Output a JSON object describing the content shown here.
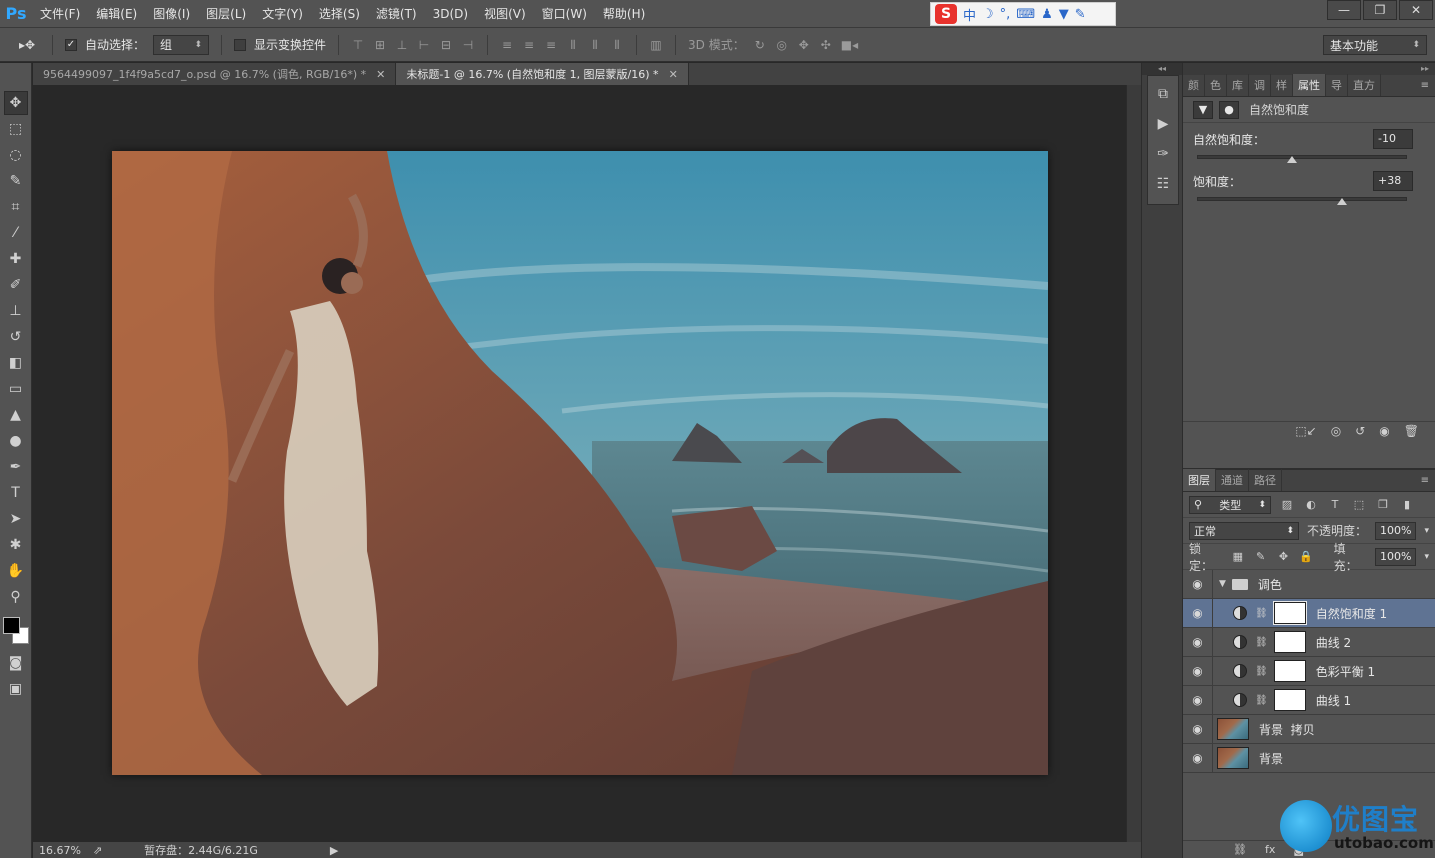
{
  "app": {
    "logo": "Ps"
  },
  "menu": [
    "文件(F)",
    "编辑(E)",
    "图像(I)",
    "图层(L)",
    "文字(Y)",
    "选择(S)",
    "滤镜(T)",
    "3D(D)",
    "视图(V)",
    "窗口(W)",
    "帮助(H)"
  ],
  "ime": {
    "logo": "S",
    "mode": "中",
    "icons": [
      "moon-icon",
      "punctuation-icon",
      "keyboard-icon",
      "user-icon",
      "shirt-icon",
      "wrench-icon"
    ]
  },
  "window_controls": [
    "—",
    "❐",
    "✕"
  ],
  "options": {
    "auto_select_label": "自动选择：",
    "auto_select_checked": true,
    "auto_select_value": "组",
    "show_transform_label": "显示变换控件",
    "show_transform_checked": false,
    "mode_3d_label": "3D 模式：",
    "workspace": "基本功能"
  },
  "tabs": [
    {
      "label": "9564499097_1f4f9a5cd7_o.psd @ 16.7% (调色, RGB/16*) *",
      "active": false
    },
    {
      "label": "未标题-1 @ 16.7% (自然饱和度 1, 图层蒙版/16) *",
      "active": true
    }
  ],
  "status": {
    "zoom": "16.67%",
    "scratch": "暂存盘：2.44G/6.21G"
  },
  "properties_panel": {
    "tabs": [
      "颜色",
      "色板",
      "库",
      "调整",
      "样式",
      "属性",
      "导航器",
      "直方图"
    ],
    "tab_labels": [
      "颜",
      "色",
      "库",
      "调",
      "样",
      "属性",
      "导",
      "直方"
    ],
    "active_tab": "属性",
    "title": "自然饱和度",
    "vibrance": {
      "label": "自然饱和度：",
      "value": "-10",
      "slider": -10
    },
    "saturation": {
      "label": "饱和度：",
      "value": "+38",
      "slider": 38
    }
  },
  "layers_panel": {
    "tabs": [
      "图层",
      "通道",
      "路径"
    ],
    "filter_type": "类型",
    "blend_mode": "正常",
    "opacity_label": "不透明度：",
    "opacity": "100%",
    "lock_label": "锁定：",
    "fill_label": "填充：",
    "fill": "100%",
    "group": {
      "name": "调色"
    },
    "adjustment_layers": [
      {
        "name": "自然饱和度 1",
        "selected": true
      },
      {
        "name": "曲线 2",
        "selected": false
      },
      {
        "name": "色彩平衡 1",
        "selected": false
      },
      {
        "name": "曲线 1",
        "selected": false
      }
    ],
    "image_layers": [
      {
        "name": "背景  拷贝"
      },
      {
        "name": "背景"
      }
    ]
  },
  "watermark": {
    "title": "优图宝",
    "url": "utobao.com"
  }
}
